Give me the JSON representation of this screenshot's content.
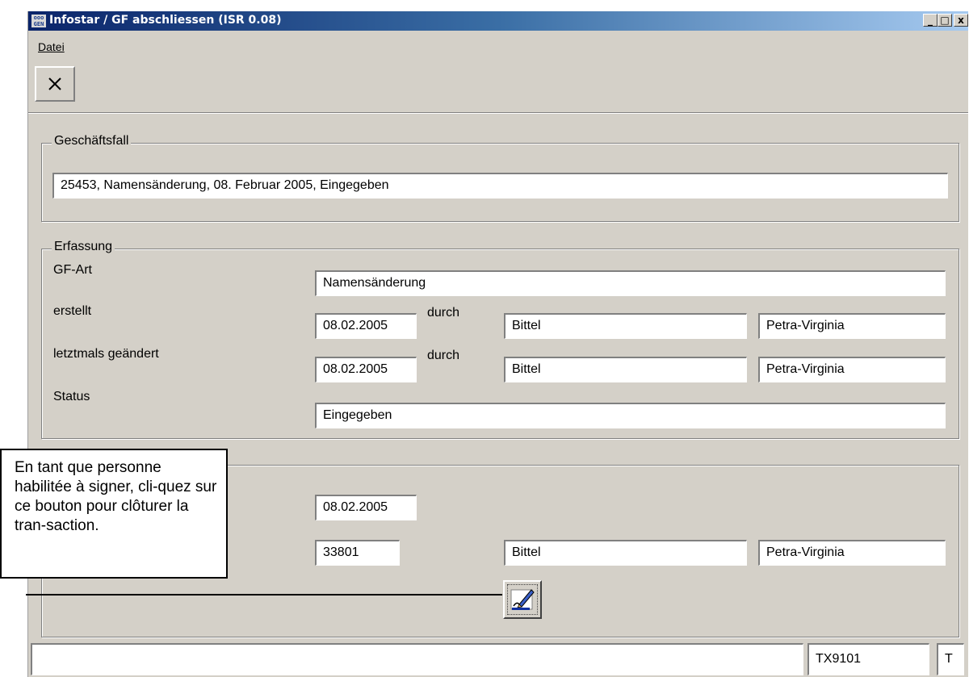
{
  "window": {
    "title": "Infostar / GF abschliessen (ISR 0.08)",
    "icon_text": "ooo GEN",
    "controls": {
      "minimize": "_",
      "maximize": "□",
      "close": "x"
    }
  },
  "menu": {
    "items": [
      {
        "label": "Datei"
      }
    ]
  },
  "toolbar": {
    "close_icon": "close-x-icon"
  },
  "geschaeftsfall": {
    "legend": "Geschäftsfall",
    "value": "25453, Namensänderung, 08. Februar 2005, Eingegeben"
  },
  "erfassung": {
    "legend": "Erfassung",
    "gf_art": {
      "label": "GF-Art",
      "value": "Namensänderung"
    },
    "erstellt": {
      "label": "erstellt",
      "date": "08.02.2005",
      "durch": "durch",
      "name": "Bittel",
      "vorname": "Petra-Virginia"
    },
    "geaendert": {
      "label": "letztmals geändert",
      "date": "08.02.2005",
      "durch": "durch",
      "name": "Bittel",
      "vorname": "Petra-Virginia"
    },
    "status": {
      "label": "Status",
      "value": "Eingegeben"
    }
  },
  "abschluss": {
    "date": "08.02.2005",
    "user_id": "33801",
    "name": "Bittel",
    "vorname": "Petra-Virginia",
    "sign_icon": "signature-pen-icon"
  },
  "statusbar": {
    "message": "",
    "code": "TX9101",
    "mode": "T"
  },
  "callout": {
    "text": "En tant que personne habilitée à signer, cli-quez sur ce bouton pour clôturer la tran-saction."
  },
  "colors": {
    "face": "#d4d0c8",
    "titlebar_start": "#0a246a",
    "titlebar_end": "#a6caf0"
  }
}
